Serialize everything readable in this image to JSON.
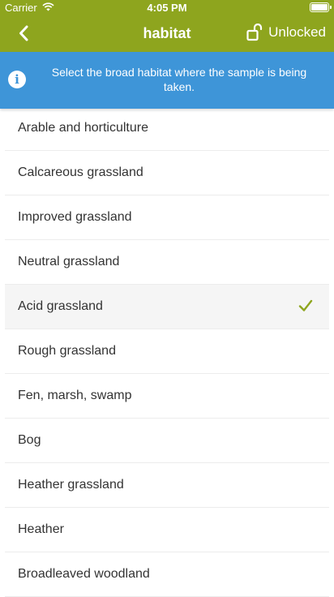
{
  "status_bar": {
    "carrier": "Carrier",
    "time": "4:05 PM"
  },
  "nav": {
    "title": "habitat",
    "lock_label": "Unlocked"
  },
  "info": {
    "text": "Select the broad habitat where the sample is being taken."
  },
  "habitats": [
    {
      "label": "Arable and horticulture",
      "selected": false
    },
    {
      "label": "Calcareous grassland",
      "selected": false
    },
    {
      "label": "Improved grassland",
      "selected": false
    },
    {
      "label": "Neutral grassland",
      "selected": false
    },
    {
      "label": "Acid grassland",
      "selected": true
    },
    {
      "label": "Rough grassland",
      "selected": false
    },
    {
      "label": "Fen, marsh, swamp",
      "selected": false
    },
    {
      "label": "Bog",
      "selected": false
    },
    {
      "label": "Heather grassland",
      "selected": false
    },
    {
      "label": "Heather",
      "selected": false
    },
    {
      "label": "Broadleaved woodland",
      "selected": false
    }
  ],
  "colors": {
    "accent": "#8ea51e",
    "info_bg": "#3e95d8",
    "check": "#8ea51e"
  },
  "icons": {
    "back": "chevron-left-icon",
    "lock": "unlock-icon",
    "info": "info-icon",
    "check": "checkmark-icon",
    "wifi": "wifi-icon",
    "battery": "battery-icon"
  }
}
